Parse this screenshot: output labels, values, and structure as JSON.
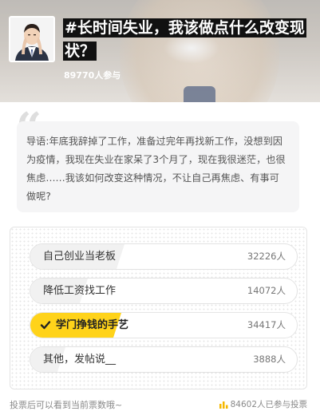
{
  "header": {
    "title": "#长时间失业，我该做点什么改变现状？",
    "participants": "89770人参与"
  },
  "intro": {
    "text": "导语:年底我辞掉了工作，准备过完年再找新工作，没想到因为疫情，我现在失业在家呆了3个月了，现在我很迷茫，也很焦虑……我该如何改变这种情况，不让自己再焦虑、有事可做呢?"
  },
  "poll": {
    "options": [
      {
        "label": "自己创业当老板",
        "count": "32226人",
        "fraction": 0.38,
        "selected": false
      },
      {
        "label": "降低工资找工作",
        "count": "14072人",
        "fraction": 0.17,
        "selected": false
      },
      {
        "label": "学门挣钱的手艺",
        "count": "34417人",
        "fraction": 0.41,
        "selected": true
      },
      {
        "label": "其他，发帖说__",
        "count": "3888人",
        "fraction": 0.05,
        "selected": false
      }
    ]
  },
  "footer": {
    "hint": "投票后可以看到当前票数哦~",
    "total": "84602人已参与投票"
  },
  "colors": {
    "accent": "#ffd31a",
    "title_bg": "#111111"
  },
  "icons": {
    "quote": "quote-icon",
    "check": "check-icon",
    "stats": "bar-chart-icon"
  }
}
